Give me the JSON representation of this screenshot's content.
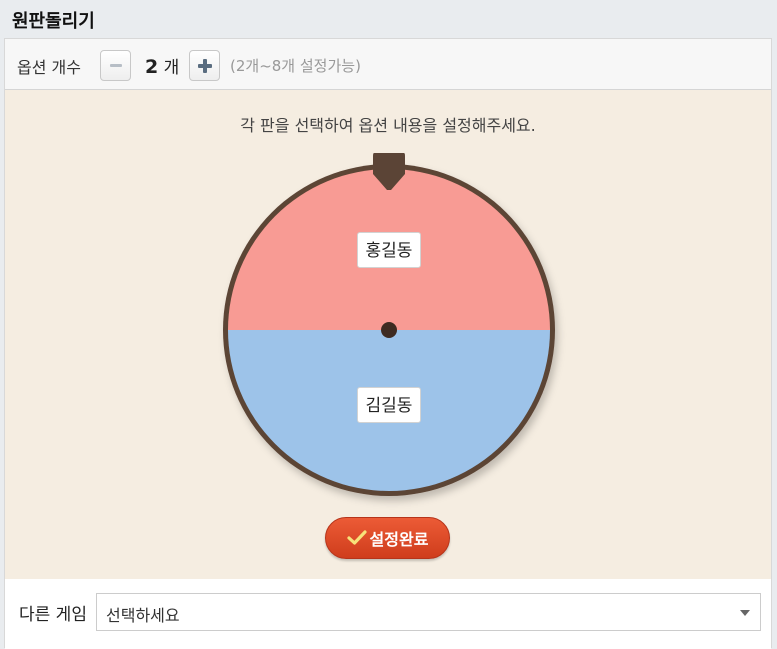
{
  "header": {
    "title": "원판돌리기"
  },
  "options": {
    "label": "옵션 개수",
    "count": "2",
    "count_unit": "개",
    "range_hint": "(2개~8개 설정가능)"
  },
  "wheel": {
    "instruction": "각 판을 선택하여 옵션 내용을 설정해주세요.",
    "segments": [
      {
        "label": "홍길동",
        "color": "#f89b94"
      },
      {
        "label": "김길동",
        "color": "#9dc3e9"
      }
    ],
    "rim_color": "#5b4436"
  },
  "actions": {
    "done_label": "설정완료"
  },
  "other_game": {
    "label": "다른 게임",
    "selected": "선택하세요"
  },
  "icons": {
    "minus": "minus-icon",
    "plus": "plus-icon",
    "check": "check-icon",
    "pointer": "pointer-icon",
    "dropdown": "chevron-down-icon"
  }
}
